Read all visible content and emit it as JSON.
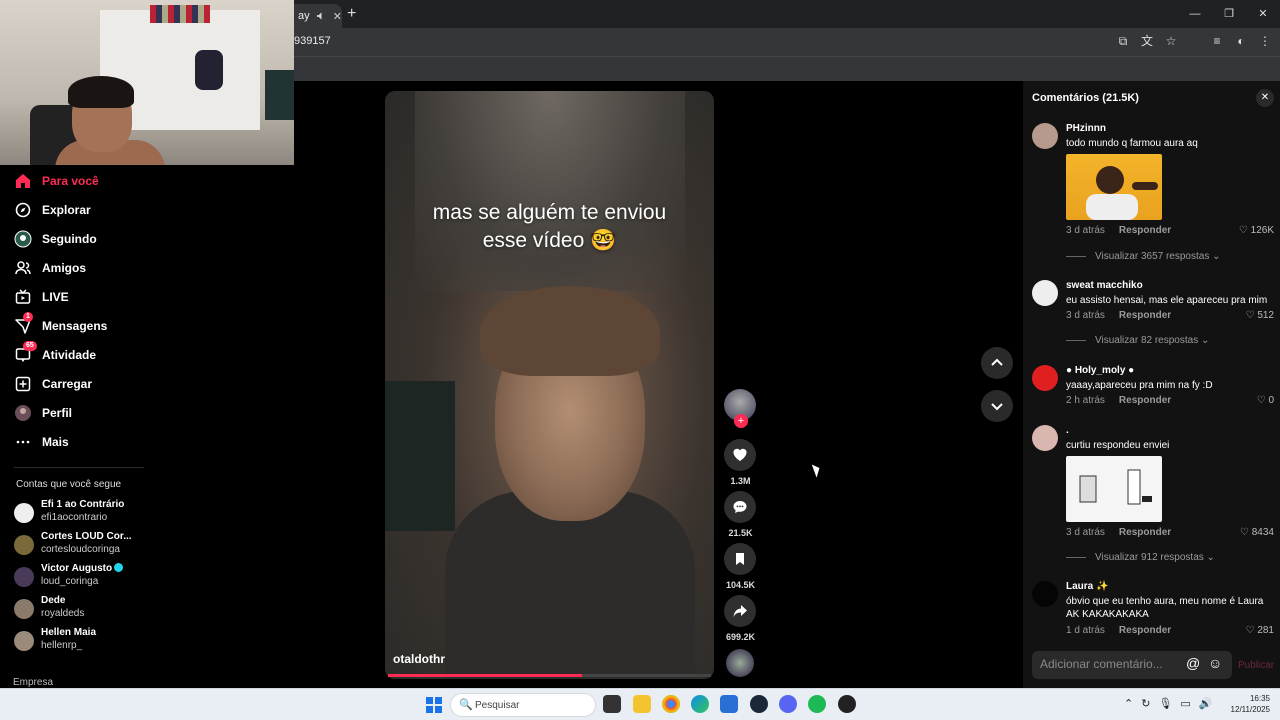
{
  "browser": {
    "tab_title": "ay",
    "url_fragment": "939157"
  },
  "sidebar": {
    "items": [
      {
        "label": "Para você",
        "icon": "home-icon"
      },
      {
        "label": "Explorar",
        "icon": "compass-icon"
      },
      {
        "label": "Seguindo",
        "icon": "following-icon"
      },
      {
        "label": "Amigos",
        "icon": "friends-icon"
      },
      {
        "label": "LIVE",
        "icon": "live-icon"
      },
      {
        "label": "Mensagens",
        "icon": "messages-icon",
        "badge": "1"
      },
      {
        "label": "Atividade",
        "icon": "activity-icon",
        "badge": "65"
      },
      {
        "label": "Carregar",
        "icon": "upload-icon"
      },
      {
        "label": "Perfil",
        "icon": "profile-icon"
      },
      {
        "label": "Mais",
        "icon": "more-icon"
      }
    ],
    "following_title": "Contas que você segue",
    "following": [
      {
        "name": "Efi 1 ao Contrário",
        "handle": "efi1aocontrario"
      },
      {
        "name": "Cortes LOUD Cor...",
        "handle": "cortesloudcoringa"
      },
      {
        "name": "Victor Augusto",
        "handle": "loud_coringa",
        "verified": true
      },
      {
        "name": "Dede",
        "handle": "royaldeds"
      },
      {
        "name": "Hellen Maia",
        "handle": "hellenrp_"
      }
    ],
    "footer": "Empresa"
  },
  "video": {
    "caption_line1": "mas se alguém te enviou",
    "caption_line2": "esse vídeo 🤓",
    "author": "otaldothr",
    "progress": 0.6
  },
  "actions": {
    "likes": "1.3M",
    "comments": "21.5K",
    "saves": "104.5K",
    "shares": "699.2K"
  },
  "comments": {
    "title": "Comentários (21.5K)",
    "input_placeholder": "Adicionar comentário...",
    "publish_label": "Publicar",
    "reply_label": "Responder",
    "items": [
      {
        "user": "PHzinnn",
        "text": "todo mundo q farmou aura aq",
        "time": "3 d atrás",
        "likes": "126K",
        "view_replies": "Visualizar 3657 respostas"
      },
      {
        "user": "sweat macchiko",
        "text": "eu assisto hensai, mas ele apareceu pra mim",
        "time": "3 d atrás",
        "likes": "512",
        "view_replies": "Visualizar 82 respostas"
      },
      {
        "user": "Holy_moly",
        "text": "yaaay,apareceu pra mim na fy :D",
        "time": "2 h atrás",
        "likes": "0"
      },
      {
        "user": ".",
        "text": "curtiu respondeu enviei",
        "time": "3 d atrás",
        "likes": "8434",
        "view_replies": "Visualizar 912 respostas"
      },
      {
        "user": "Laura ✨",
        "text": "óbvio que eu tenho aura, meu nome é Laura AK KAKAKAKAKA",
        "time": "1 d atrás",
        "likes": "281"
      }
    ]
  },
  "taskbar": {
    "search_label": "Pesquisar",
    "time": "16:35",
    "date": "12/11/2025"
  }
}
